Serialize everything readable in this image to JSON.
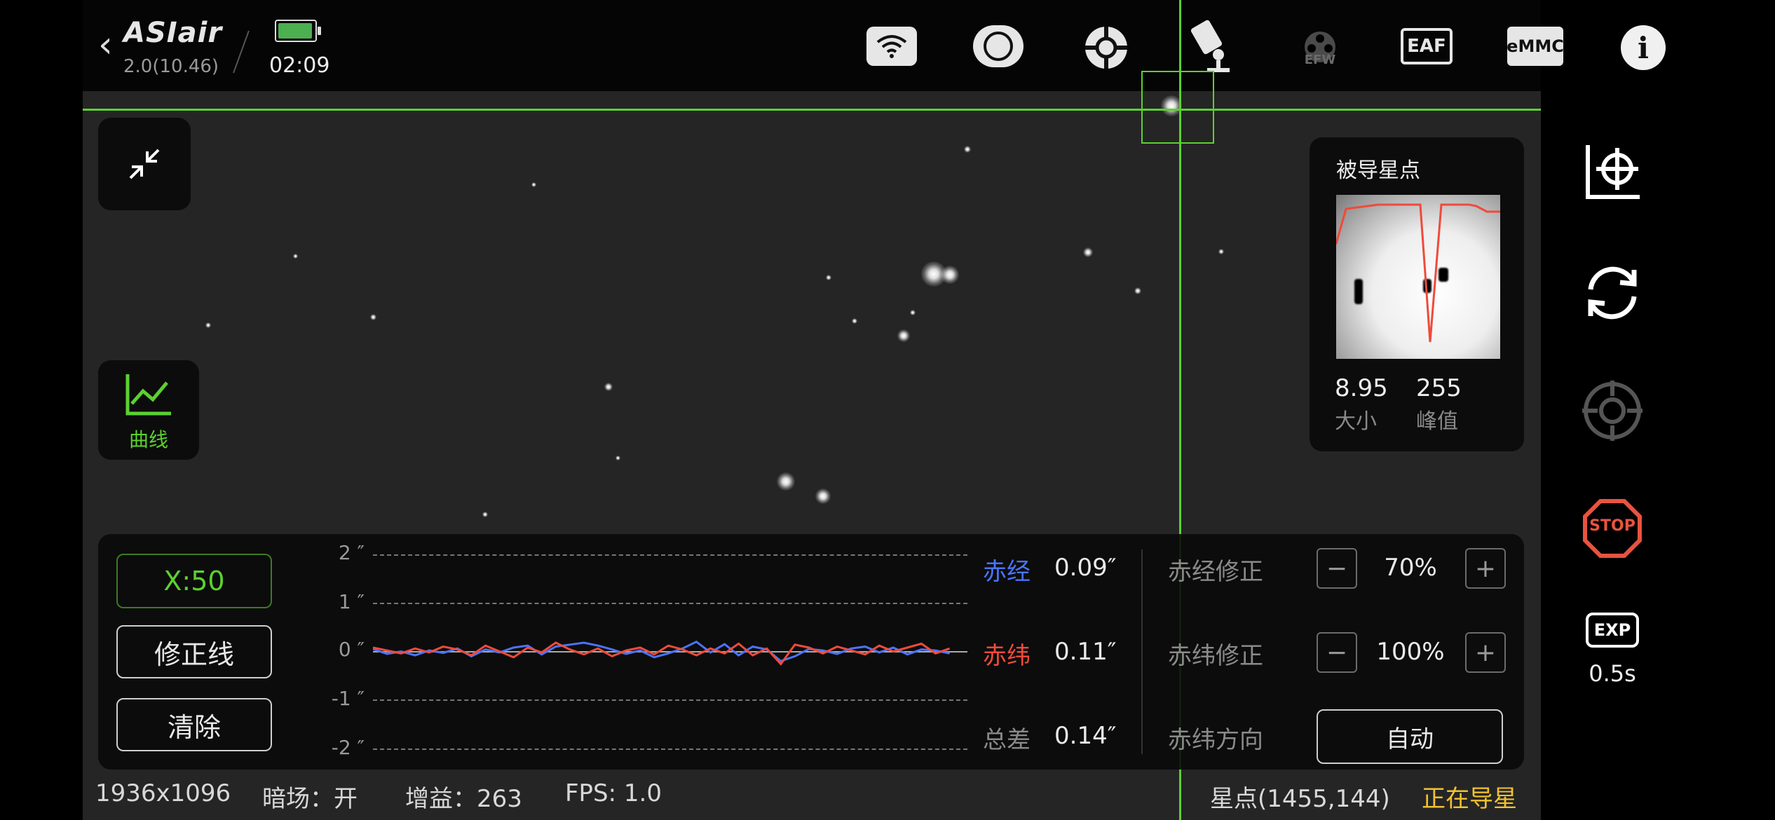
{
  "header": {
    "app_name": "ASIair",
    "version": "2.0(10.46)",
    "time": "02:09",
    "battery_color": "#4caf50"
  },
  "top_icons": [
    "wifi-icon",
    "camera-icon",
    "guide-scope-icon",
    "telescope-mount-icon",
    "efw-icon",
    "eaf-icon",
    "emmc-icon",
    "info-icon"
  ],
  "top_icon_labels": {
    "efw": "EFW",
    "eaf": "EAF",
    "emmc": "eMMC",
    "info": "i"
  },
  "left_panel": {
    "collapse_icon": "collapse-icon",
    "curve_label": "曲线"
  },
  "star_panel": {
    "title": "被导星点",
    "size_value": "8.95",
    "size_label": "大小",
    "peak_value": "255",
    "peak_label": "峰值"
  },
  "graph": {
    "x_scale_button": "X:50",
    "correction_button": "修正线",
    "clear_button": "清除",
    "y_labels": [
      "2 ″",
      "1 ″",
      "0 ″",
      "-1 ″",
      "-2 ″"
    ],
    "ra_label": "赤经",
    "ra_value": "0.09″",
    "dec_label": "赤纬",
    "dec_value": "0.11″",
    "total_label": "总差",
    "total_value": "0.14″",
    "ra_color": "#4a74ff",
    "dec_color": "#f04a3a",
    "ra_series": [
      0.05,
      -0.05,
      0.0,
      -0.08,
      0.02,
      -0.03,
      0.06,
      -0.1,
      0.04,
      -0.02,
      0.08,
      0.12,
      -0.06,
      0.1,
      0.14,
      0.18,
      0.12,
      0.04,
      -0.05,
      0.02,
      -0.12,
      -0.04,
      0.06,
      0.2,
      -0.02,
      0.15,
      -0.08,
      0.1,
      0.04,
      -0.2,
      -0.1,
      0.05,
      0.02,
      -0.05,
      0.06,
      0.1,
      -0.02,
      0.08,
      -0.06,
      0.04,
      0.02,
      -0.04
    ],
    "dec_series": [
      0.08,
      0.02,
      -0.04,
      0.06,
      -0.02,
      0.1,
      0.04,
      -0.08,
      0.12,
      0.0,
      -0.12,
      0.08,
      -0.02,
      0.18,
      0.04,
      -0.06,
      0.06,
      -0.1,
      0.02,
      0.08,
      -0.06,
      0.12,
      0.04,
      -0.08,
      0.06,
      -0.04,
      0.16,
      -0.08,
      0.06,
      -0.26,
      0.14,
      0.08,
      -0.04,
      0.1,
      0.02,
      -0.06,
      0.12,
      0.0,
      0.08,
      0.16,
      -0.04,
      0.06
    ],
    "ra_corr_label": "赤经修正",
    "ra_corr_value": "70%",
    "dec_corr_label": "赤纬修正",
    "dec_corr_value": "100%",
    "dec_dir_label": "赤纬方向",
    "dec_dir_value": "自动",
    "minus": "−",
    "plus": "+"
  },
  "status_bar": {
    "resolution": "1936x1096",
    "dark": "暗场：开",
    "gain": "增益：263",
    "fps": "FPS: 1.0",
    "star_pos": "星点(1455,144)",
    "guiding": "正在导星",
    "guiding_color": "#f2c230"
  },
  "right_bar": {
    "stop_label": "STOP",
    "exp_label": "EXP",
    "exp_value": "0.5s",
    "stop_color": "#e8533f"
  },
  "crosshair_color": "#5bd12f"
}
